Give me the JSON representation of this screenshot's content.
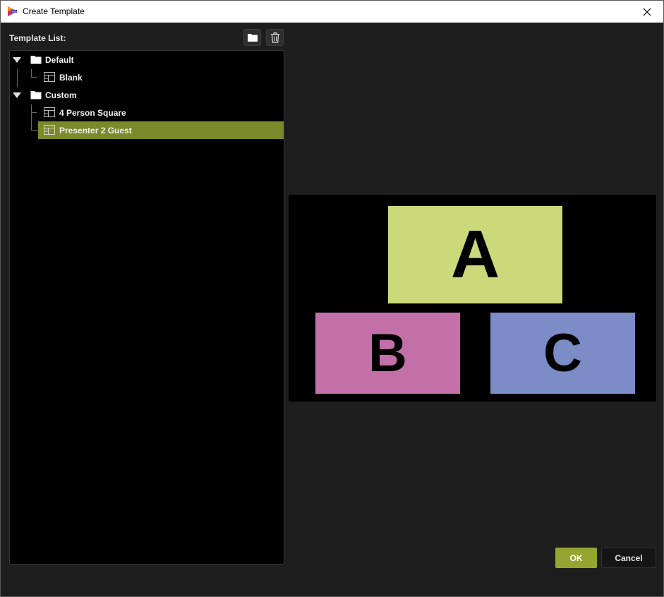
{
  "window": {
    "title": "Create Template"
  },
  "template_list": {
    "label": "Template List:",
    "groups": [
      {
        "name": "Default",
        "items": [
          {
            "name": "Blank",
            "selected": false
          }
        ]
      },
      {
        "name": "Custom",
        "items": [
          {
            "name": "4 Person Square",
            "selected": false
          },
          {
            "name": "Presenter 2 Guest",
            "selected": true
          }
        ]
      }
    ]
  },
  "preview": {
    "tiles": [
      {
        "label": "A",
        "color": "#cbd97a"
      },
      {
        "label": "B",
        "color": "#c470a8"
      },
      {
        "label": "C",
        "color": "#7b8cc6"
      }
    ]
  },
  "buttons": {
    "ok": "OK",
    "cancel": "Cancel"
  },
  "colors": {
    "accent": "#95a532",
    "selection": "#7a8a2a",
    "background": "#1e1e1e"
  },
  "icons": {
    "app": "app-logo-icon",
    "close": "close-icon",
    "folder_button": "folder-icon",
    "delete_button": "trash-icon",
    "group": "folder-icon",
    "template": "layout-icon",
    "expand": "caret-down-icon"
  }
}
